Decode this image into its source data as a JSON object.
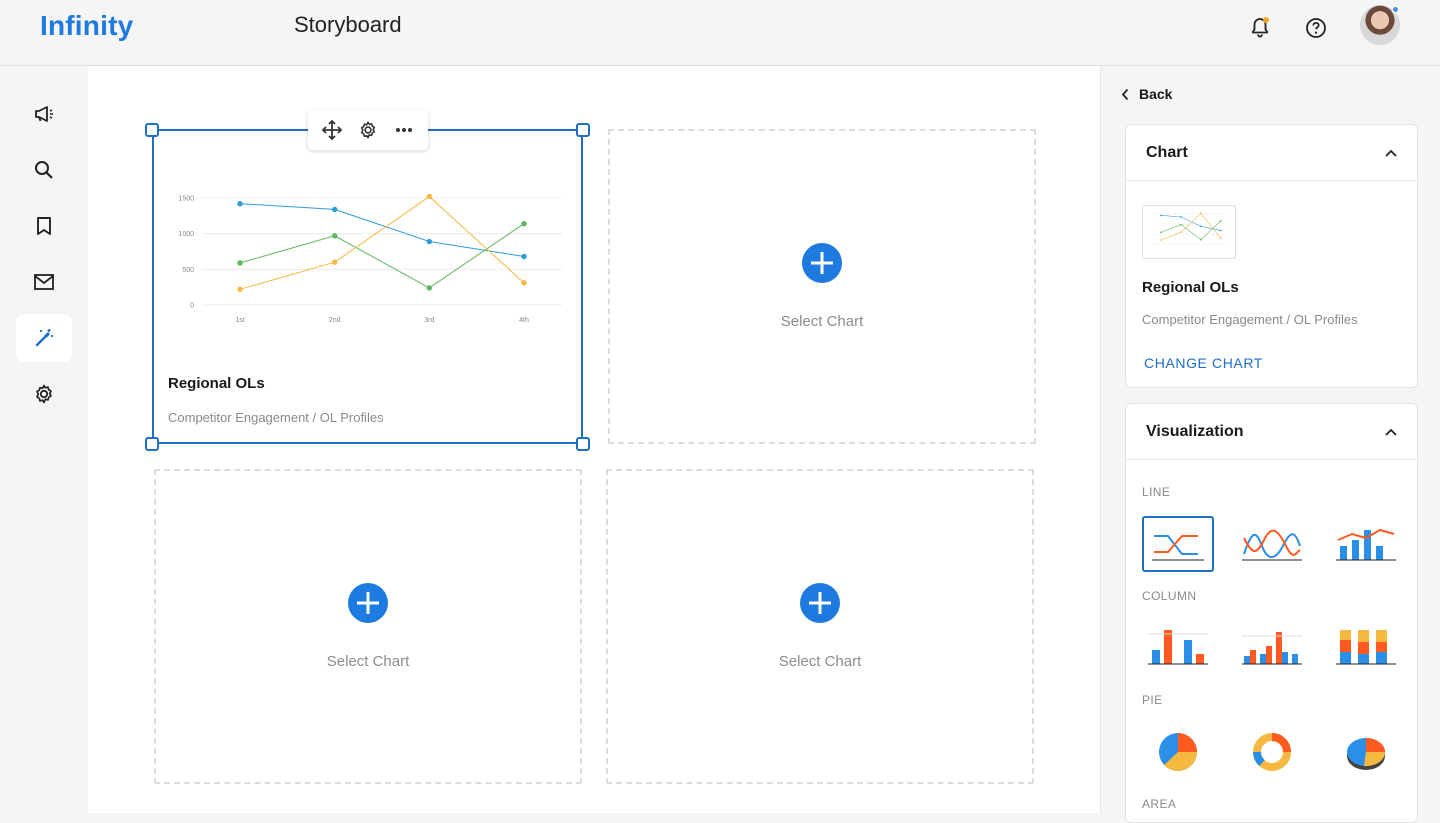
{
  "header": {
    "logo": "Infinity",
    "title": "Storyboard",
    "icons": [
      "bell-icon",
      "help-icon"
    ],
    "colors": {
      "brand": "#1f7ae0",
      "selection": "#1f6fc5",
      "notif_dot": "#f5a623"
    }
  },
  "rail": {
    "items": [
      "megaphone-icon",
      "search-icon",
      "bookmark-icon",
      "mail-icon",
      "magic-wand-icon",
      "settings-icon"
    ],
    "active": "magic-wand-icon"
  },
  "canvas": {
    "selected_card": {
      "title": "Regional OLs",
      "subtitle": "Competitor Engagement  / OL Profiles",
      "toolbar": [
        "move-icon",
        "gear-icon",
        "more-icon"
      ]
    },
    "empty_slot_label": "Select Chart",
    "slots": [
      {
        "label": "Select Chart"
      },
      {
        "label": "Select Chart"
      },
      {
        "label": "Select Chart"
      }
    ]
  },
  "chart_data": {
    "type": "line",
    "categories": [
      "1st",
      "2nd",
      "3rd",
      "4th"
    ],
    "yticks": [
      0,
      500,
      1000,
      1500
    ],
    "ylim": [
      0,
      1500
    ],
    "series": [
      {
        "color": "#2d9cdb",
        "values": [
          1420,
          1340,
          890,
          680
        ]
      },
      {
        "color": "#5cb85c",
        "values": [
          590,
          970,
          240,
          1140
        ]
      },
      {
        "color": "#f5b942",
        "values": [
          220,
          600,
          1520,
          310
        ]
      }
    ],
    "grid": true
  },
  "rpanel": {
    "back_label": "Back",
    "chart_section": {
      "title": "Chart",
      "chart_title": "Regional OLs",
      "chart_sub": "Competitor Engagement  / OL Profiles",
      "change_label": "CHANGE CHART"
    },
    "visualization": {
      "title": "Visualization",
      "groups": [
        {
          "label": "LINE",
          "options": [
            "line-icon",
            "smooth-line-icon",
            "line-bar-combo-icon"
          ],
          "selected": 0
        },
        {
          "label": "COLUMN",
          "options": [
            "column-icon",
            "grouped-column-icon",
            "stacked-column-icon"
          ]
        },
        {
          "label": "PIE",
          "options": [
            "pie-icon",
            "donut-icon",
            "pie-3d-icon"
          ]
        },
        {
          "label": "AREA",
          "options": []
        }
      ]
    }
  }
}
